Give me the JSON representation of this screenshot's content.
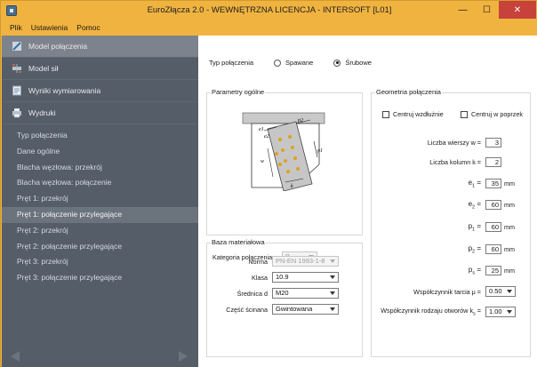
{
  "window": {
    "title": "EuroZłącza 2.0 - WEWNĘTRZNA LICENCJA - INTERSOFT [L01]",
    "minimize": "—",
    "maximize": "☐",
    "close": "✕"
  },
  "menu": [
    "Plik",
    "Ustawienia",
    "Pomoc"
  ],
  "sidebar": {
    "main": [
      {
        "label": "Model połączenia",
        "icon": "connection-model-icon",
        "active": true
      },
      {
        "label": "Model sił",
        "icon": "forces-model-icon",
        "active": false
      },
      {
        "label": "Wyniki wymiarowania",
        "icon": "results-icon",
        "active": false
      },
      {
        "label": "Wydruki",
        "icon": "printer-icon",
        "active": false
      }
    ],
    "sub": [
      {
        "label": "Typ połączenia",
        "active": false
      },
      {
        "label": "Dane ogólne",
        "active": false
      },
      {
        "label": "Blacha węzłowa: przekrój",
        "active": false
      },
      {
        "label": "Blacha węzłowa: połączenie",
        "active": false
      },
      {
        "label": "Pręt 1: przekrój",
        "active": false
      },
      {
        "label": "Pręt 1: połączenie przylegające",
        "active": true
      },
      {
        "label": "Pręt 2: przekrój",
        "active": false
      },
      {
        "label": "Pręt 2: połączenie przylegające",
        "active": false
      },
      {
        "label": "Pręt 3: przekrój",
        "active": false
      },
      {
        "label": "Pręt 3: połączenie przylegające",
        "active": false
      }
    ]
  },
  "connection_type": {
    "label": "Typ połączenia",
    "options": [
      "Spawane",
      "Śrubowe"
    ],
    "selected": "Śrubowe"
  },
  "general": {
    "title": "Parametry ogólne",
    "category_label": "Kategoria połączenia",
    "category_value": "B",
    "diagram_labels": {
      "e1": "e1",
      "e2": "e2",
      "p2": "p2",
      "w": "w",
      "p1": "p1",
      "k": "k"
    }
  },
  "material": {
    "title": "Baza materiałowa",
    "norm_label": "Norma",
    "norm_value": "PN-EN 1993-1-8",
    "class_label": "Klasa",
    "class_value": "10.9",
    "diameter_label": "Średnica d",
    "diameter_value": "M20",
    "shear_label": "Część ścinana",
    "shear_value": "Gwintowana"
  },
  "geometry": {
    "title": "Geometria połączenia",
    "center_long": "Centruj wzdłużnie",
    "center_cross": "Centruj w poprzek",
    "rows_label": "Liczba wierszy w =",
    "rows_value": "3",
    "cols_label": "Liczba kolumn k =",
    "cols_value": "2",
    "e1": {
      "sym": "e",
      "sub": "1",
      "value": "35",
      "unit": "mm"
    },
    "e2": {
      "sym": "e",
      "sub": "2",
      "value": "60",
      "unit": "mm"
    },
    "p1": {
      "sym": "p",
      "sub": "1",
      "value": "60",
      "unit": "mm"
    },
    "p2": {
      "sym": "p",
      "sub": "2",
      "value": "60",
      "unit": "mm"
    },
    "ps": {
      "sym": "p",
      "sub": "s",
      "value": "25",
      "unit": "mm"
    },
    "friction_label": "Współczynnik tarcia μ =",
    "friction_value": "0.50",
    "holes_label": "Współczynnik rodzaju otworów k",
    "holes_sub": "s",
    "holes_value": "1.00"
  }
}
